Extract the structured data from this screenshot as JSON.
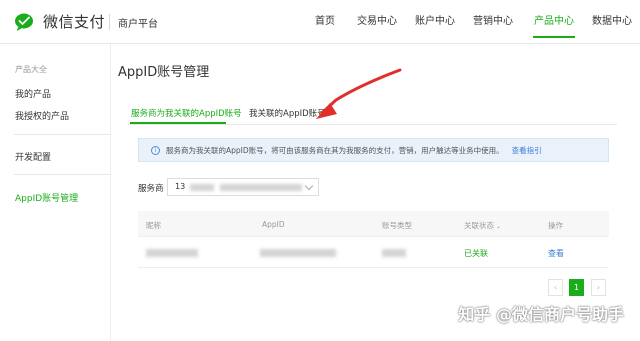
{
  "header": {
    "brand": "微信支付",
    "merchant": "商户平台",
    "nav": [
      {
        "label": "首页",
        "active": false
      },
      {
        "label": "交易中心",
        "active": false
      },
      {
        "label": "账户中心",
        "active": false
      },
      {
        "label": "营销中心",
        "active": false
      },
      {
        "label": "产品中心",
        "active": true
      },
      {
        "label": "数据中心",
        "active": false
      }
    ]
  },
  "sidebar": {
    "section": "产品大全",
    "items": [
      "我的产品",
      "我授权的产品",
      "开发配置",
      "AppID账号管理"
    ]
  },
  "page": {
    "title": "AppID账号管理",
    "tabs": [
      "服务商为我关联的AppID账号",
      "我关联的AppID账号"
    ],
    "info_text": "服务商为我关联的AppID账号，将可由该服务商在其为我服务的支付，营销，用户触达等业务中使用。",
    "info_link": "查看指引",
    "filter_label": "服务商",
    "filter_value_prefix": "13"
  },
  "table": {
    "headers": [
      "昵称",
      "AppID",
      "账号类型",
      "关联状态",
      "操作"
    ],
    "rows": [
      {
        "status": "已关联",
        "action": "查看"
      }
    ]
  },
  "pagination": {
    "prev": "‹",
    "current": "1",
    "next": "›"
  },
  "watermark": "知乎 @微信商户号助手",
  "colors": {
    "accent": "#1aad19",
    "link": "#3b7ad6",
    "arrow": "#e0302b"
  }
}
